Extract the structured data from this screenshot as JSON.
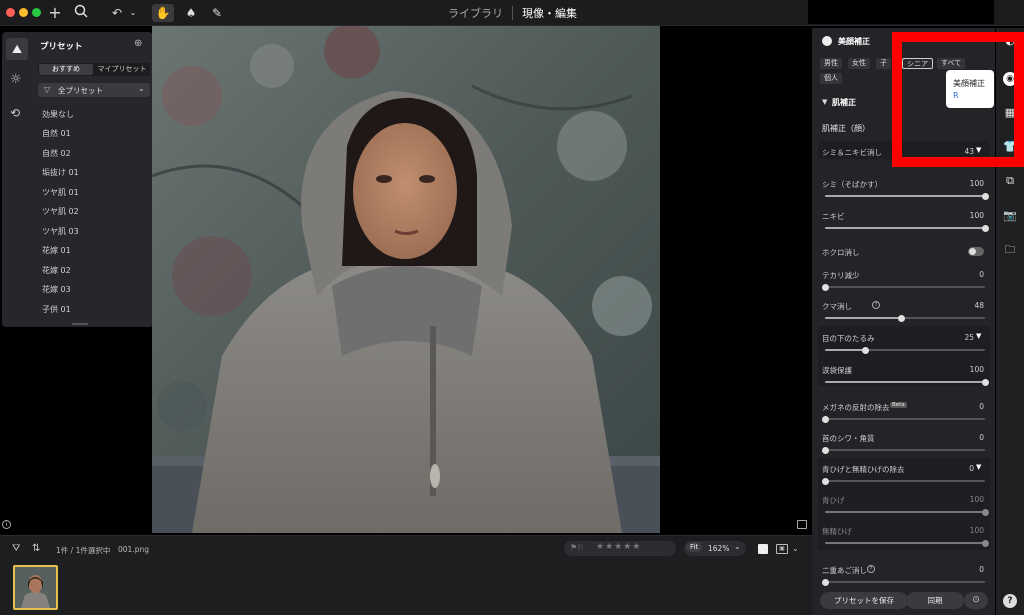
{
  "toolbar": {
    "tabs": [
      "ライブラリ",
      "現像・編集"
    ]
  },
  "left_panel": {
    "title": "プリセット",
    "tabs": [
      "おすすめ",
      "マイプリセット"
    ],
    "dropdown": "全プリセット",
    "items": [
      "効果なし",
      "自然 01",
      "自然 02",
      "垢抜け 01",
      "ツヤ肌 01",
      "ツヤ肌 02",
      "ツヤ肌 03",
      "花嫁 01",
      "花嫁 02",
      "花嫁 03",
      "子供 01"
    ]
  },
  "right_panel": {
    "title": "美顔補正",
    "chips": [
      "男性",
      "女性",
      "子",
      "シニア",
      "すべて",
      "個人"
    ],
    "tooltip": {
      "title": "美顔補正",
      "shortcut": "R"
    },
    "section": "肌補正",
    "subsection": "肌補正（顔）",
    "controls": [
      {
        "label": "シミ＆ニキビ消し",
        "value": "43",
        "dropdown": true
      },
      {
        "label": "シミ（そばかす）",
        "value": "100",
        "level": 1.0
      },
      {
        "label": "ニキビ",
        "value": "100",
        "level": 1.0
      },
      {
        "label": "ホクロ消し",
        "toggle": true
      },
      {
        "label": "テカリ減少",
        "value": "0",
        "level": 0.0
      },
      {
        "label": "クマ消し",
        "value": "48",
        "level": 0.48
      },
      {
        "label": "目の下のたるみ",
        "value": "25",
        "level": 0.25,
        "dropdown": true
      },
      {
        "label": "涙袋保護",
        "value": "100",
        "level": 1.0
      },
      {
        "label": "メガネの反射の除去",
        "badge": "Beta",
        "value": "0",
        "level": 0.0
      },
      {
        "label": "首のシワ・角質",
        "value": "0",
        "level": 0.0
      },
      {
        "label": "青ひげと無精ひげの除去",
        "value": "0",
        "level": 0.0,
        "dropdown": true
      },
      {
        "label": "青ひげ",
        "value": "100",
        "level": 1.0,
        "dim": true
      },
      {
        "label": "無精ひげ",
        "value": "100",
        "level": 1.0,
        "dim": true
      },
      {
        "label": "二重あご消し",
        "value": "0",
        "level": 0.0
      }
    ],
    "save_button": "プリセットを保存",
    "sync_button": "同期"
  },
  "bottom": {
    "selection": "1件 / 1件選択中",
    "filename": "001.png",
    "fit_label": "Fit",
    "zoom": "162%"
  },
  "colors": {
    "accent": "#e8c04a",
    "highlight_box": "#ff0000",
    "toggle_off": "#666666"
  }
}
